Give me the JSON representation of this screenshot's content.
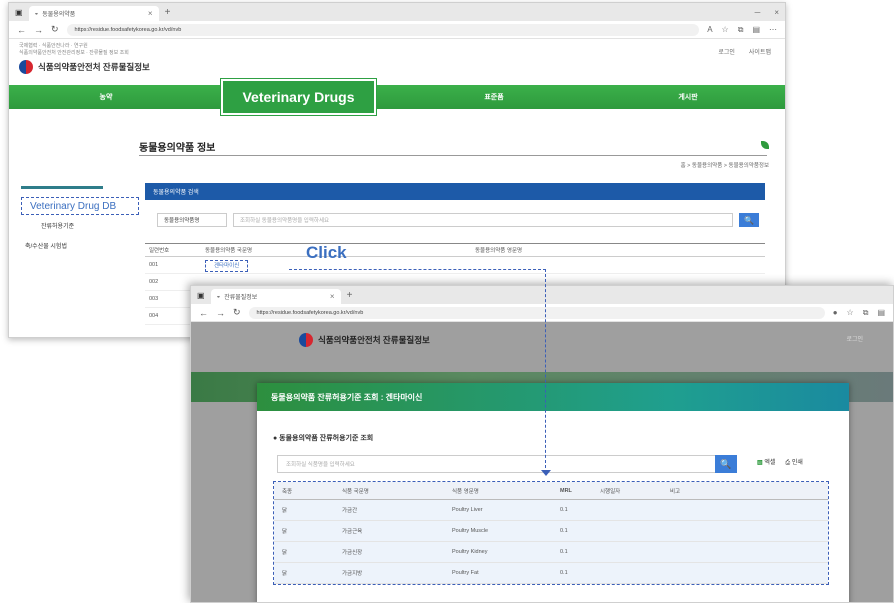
{
  "win1": {
    "tab_title": "동물용의약품",
    "url": "https://residue.foodsafetykorea.go.kr/vd/nvb",
    "util_line1": "국제협력 · 식품안전나라 · 연구원",
    "util_line2": "식품의약품안전처 안전관리정보 · 잔류물질 정보 조회",
    "logo_text": "식품의약품안전처 잔류물질정보",
    "header_right": [
      "로그인",
      "사이트맵"
    ],
    "nav": [
      "농약",
      "Veterinary Drugs",
      "표준품",
      "게시판"
    ],
    "page_title": "동물용의약품 정보",
    "breadcrumb": "홈 > 동물용의약품 > 동물용의약품정보",
    "sidebar_highlight": "Veterinary Drug DB",
    "sidebar_items": [
      "잔류허용기준",
      "축/수산물 시험법"
    ],
    "blue_bar": "동물용의약품 검색",
    "search_select": "동물용의약품명",
    "search_placeholder": "조회하실 동물용의약품명을 입력하세요",
    "search_btn": "🔍",
    "table": {
      "headers": [
        "일련번호",
        "동물용의약품 국문명",
        "동물용의약품 영문명"
      ],
      "rows": [
        [
          "001",
          "겐타마이신",
          ""
        ],
        [
          "002",
          "",
          ""
        ],
        [
          "003",
          "",
          ""
        ],
        [
          "004",
          "",
          ""
        ]
      ]
    }
  },
  "annotation": {
    "click_label": "Click"
  },
  "win2": {
    "tab_title": "잔류물질정보",
    "url": "https://residue.foodsafetykorea.go.kr/vd/nvb",
    "logo_text": "식품의약품안전처 잔류물질정보",
    "header_right": "로그인",
    "modal_title": "동물용의약품 잔류허용기준 조회 : 겐타마이신",
    "modal_sub": "● 동물용의약품 잔류허용기준 조회",
    "search_placeholder": "조회하실 식품명을 입력하세요",
    "search_btn": "🔍",
    "actions": [
      "엑셀",
      "인쇄"
    ],
    "table": {
      "headers": [
        "축종",
        "식품 국문명",
        "식품 영문명",
        "MRL",
        "시행일자",
        "비고"
      ],
      "rows": [
        [
          "닭",
          "가금간",
          "Poultry Liver",
          "0.1",
          "",
          ""
        ],
        [
          "닭",
          "가금근육",
          "Poultry Muscle",
          "0.1",
          "",
          ""
        ],
        [
          "닭",
          "가금신장",
          "Poultry Kidney",
          "0.1",
          "",
          ""
        ],
        [
          "닭",
          "가금지방",
          "Poultry Fat",
          "0.1",
          "",
          ""
        ]
      ]
    }
  }
}
